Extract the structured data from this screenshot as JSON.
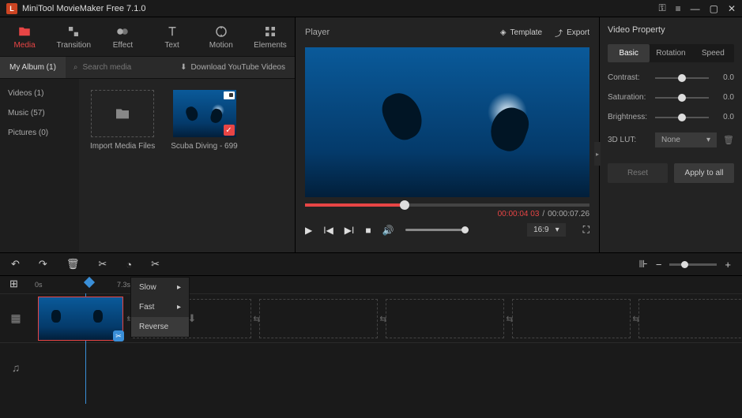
{
  "titlebar": {
    "title": "MiniTool MovieMaker Free 7.1.0"
  },
  "tabs": [
    {
      "label": "Media"
    },
    {
      "label": "Transition"
    },
    {
      "label": "Effect"
    },
    {
      "label": "Text"
    },
    {
      "label": "Motion"
    },
    {
      "label": "Elements"
    }
  ],
  "mediabar": {
    "album": "My Album (1)",
    "search_placeholder": "Search media",
    "download": "Download YouTube Videos"
  },
  "sidebar": [
    {
      "label": "Videos (1)"
    },
    {
      "label": "Music (57)"
    },
    {
      "label": "Pictures (0)"
    }
  ],
  "media": {
    "import": "Import Media Files",
    "clip": "Scuba Diving - 699"
  },
  "player": {
    "title": "Player",
    "template": "Template",
    "export": "Export",
    "current": "00:00:04 03",
    "total": "00:00:07.26",
    "ratio": "16:9"
  },
  "props": {
    "title": "Video Property",
    "tabs": [
      "Basic",
      "Rotation",
      "Speed"
    ],
    "contrast": {
      "label": "Contrast:",
      "value": "0.0"
    },
    "saturation": {
      "label": "Saturation:",
      "value": "0.0"
    },
    "brightness": {
      "label": "Brightness:",
      "value": "0.0"
    },
    "lut": {
      "label": "3D LUT:",
      "value": "None"
    },
    "reset": "Reset",
    "apply": "Apply to all"
  },
  "speed_menu": [
    "Slow",
    "Fast",
    "Reverse"
  ],
  "ruler": {
    "t0": "0s",
    "t1": "7.3s"
  }
}
